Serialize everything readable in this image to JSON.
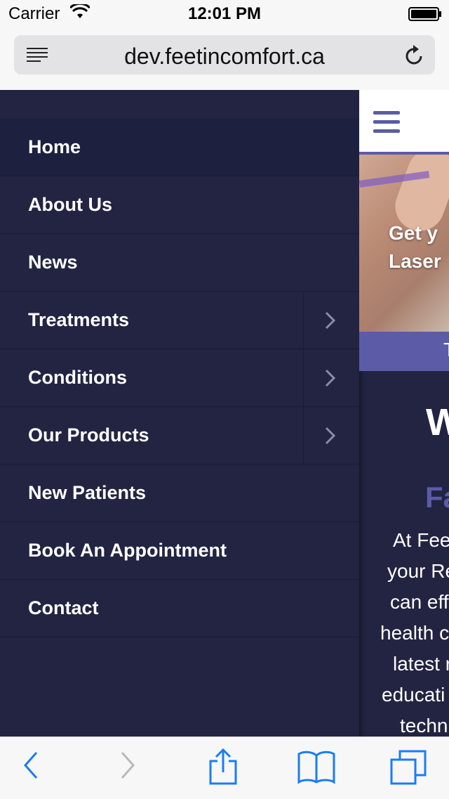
{
  "status": {
    "carrier": "Carrier",
    "time": "12:01 PM"
  },
  "browser": {
    "url": "dev.feetincomfort.ca"
  },
  "nav": {
    "items": [
      {
        "label": "Home",
        "submenu": false
      },
      {
        "label": "About Us",
        "submenu": false
      },
      {
        "label": "News",
        "submenu": false
      },
      {
        "label": "Treatments",
        "submenu": true
      },
      {
        "label": "Conditions",
        "submenu": true
      },
      {
        "label": "Our Products",
        "submenu": true
      },
      {
        "label": "New Patients",
        "submenu": false
      },
      {
        "label": "Book An Appointment",
        "submenu": false
      },
      {
        "label": "Contact",
        "submenu": false
      }
    ]
  },
  "main": {
    "hero_line1": "Get y",
    "hero_line2": "Laser",
    "bar_text": "T",
    "welcome": "W",
    "heading": "Fa",
    "paragraph": [
      "At Fee",
      "your Re",
      "can eff",
      "health c",
      "latest r",
      "educati",
      "techn"
    ]
  },
  "colors": {
    "nav_bg": "#222442",
    "accent": "#5c5ba8",
    "ios_blue": "#1a7cf4"
  }
}
